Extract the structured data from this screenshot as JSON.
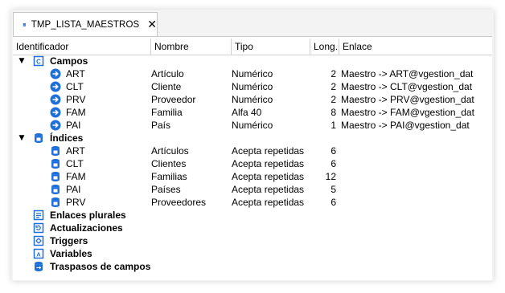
{
  "tab": {
    "title": "TMP_LISTA_MAESTROS",
    "close_glyph": "✕"
  },
  "columns": [
    "Identificador",
    "Nombre",
    "Tipo",
    "Long.",
    "Enlace"
  ],
  "tree": {
    "campos": {
      "label": "Campos",
      "toggle": "▼",
      "rows": [
        {
          "id": "ART",
          "nombre": "Artículo",
          "tipo": "Numérico",
          "long": "2",
          "enlace": "Maestro -> ART@vgestion_dat"
        },
        {
          "id": "CLT",
          "nombre": "Cliente",
          "tipo": "Numérico",
          "long": "2",
          "enlace": "Maestro -> CLT@vgestion_dat"
        },
        {
          "id": "PRV",
          "nombre": "Proveedor",
          "tipo": "Numérico",
          "long": "2",
          "enlace": "Maestro -> PRV@vgestion_dat"
        },
        {
          "id": "FAM",
          "nombre": "Familia",
          "tipo": "Alfa 40",
          "long": "8",
          "enlace": "Maestro -> FAM@vgestion_dat"
        },
        {
          "id": "PAI",
          "nombre": "País",
          "tipo": "Numérico",
          "long": "1",
          "enlace": "Maestro -> PAI@vgestion_dat"
        }
      ]
    },
    "indices": {
      "label": "Índices",
      "toggle": "▼",
      "rows": [
        {
          "id": "ART",
          "nombre": "Artículos",
          "tipo": "Acepta repetidas",
          "long": "6"
        },
        {
          "id": "CLT",
          "nombre": "Clientes",
          "tipo": "Acepta repetidas",
          "long": "6"
        },
        {
          "id": "FAM",
          "nombre": "Familias",
          "tipo": "Acepta repetidas",
          "long": "12"
        },
        {
          "id": "PAI",
          "nombre": "Países",
          "tipo": "Acepta repetidas",
          "long": "5"
        },
        {
          "id": "PRV",
          "nombre": "Proveedores",
          "tipo": "Acepta repetidas",
          "long": "6"
        }
      ]
    },
    "other_nodes": [
      "Enlaces plurales",
      "Actualizaciones",
      "Triggers",
      "Variables",
      "Traspasos de campos"
    ]
  },
  "colors": {
    "accent": "#1e6fd9",
    "border": "#c8c8c8",
    "frame_bg": "#f3f3f3"
  }
}
